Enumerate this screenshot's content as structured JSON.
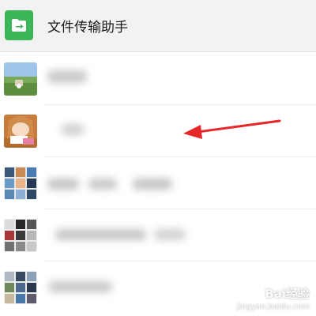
{
  "header": {
    "icon": "folder-arrow-icon",
    "title": "文件传输助手",
    "accent": "#3db65a"
  },
  "chats": [
    {
      "avatar": "landscape-avatar"
    },
    {
      "avatar": "anime-character-avatar"
    },
    {
      "avatar": "anime-collage-avatar"
    },
    {
      "avatar": "photo-grid-avatar"
    },
    {
      "avatar": "photo-grid-avatar-2"
    }
  ],
  "annotation": {
    "icon": "red-arrow-icon",
    "color": "#e8262a"
  },
  "watermark": {
    "main": "Bai经验",
    "url": "jingyan.baidu.com"
  }
}
